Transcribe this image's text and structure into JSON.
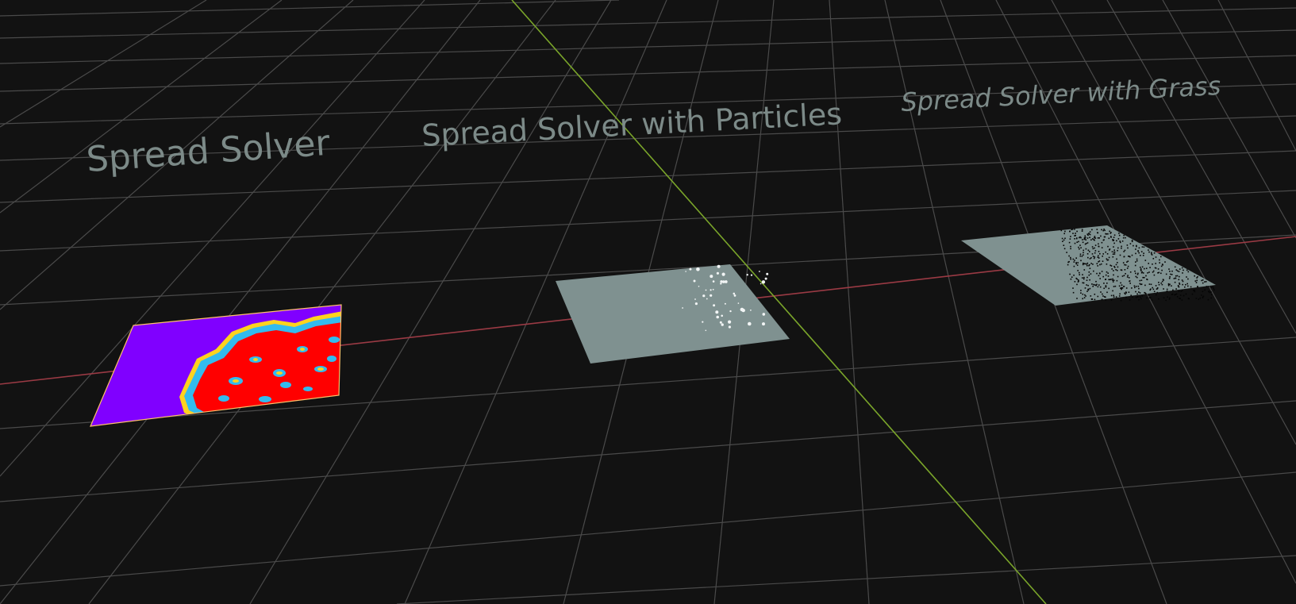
{
  "viewport": {
    "background": "#121212",
    "grid_color": "#4a4a4a",
    "x_axis_color": "#9a3a44",
    "z_axis_color": "#7aa52a",
    "label_color": "#7c8a88"
  },
  "objects": [
    {
      "label": "Spread Solver",
      "surface": "heatmap"
    },
    {
      "label": "Spread Solver with Particles",
      "surface": "grey plane with white particles",
      "plane_color": "#7f9190"
    },
    {
      "label": "Spread Solver with Grass",
      "surface": "grey plane with black grass",
      "plane_color": "#7f9190"
    }
  ],
  "heatmap_colors": {
    "background": "#8000ff",
    "hot": "#ff0000",
    "edge_cyan": "#33bbee",
    "edge_yellow": "#ffd21e",
    "outline": "#ffc06a"
  }
}
